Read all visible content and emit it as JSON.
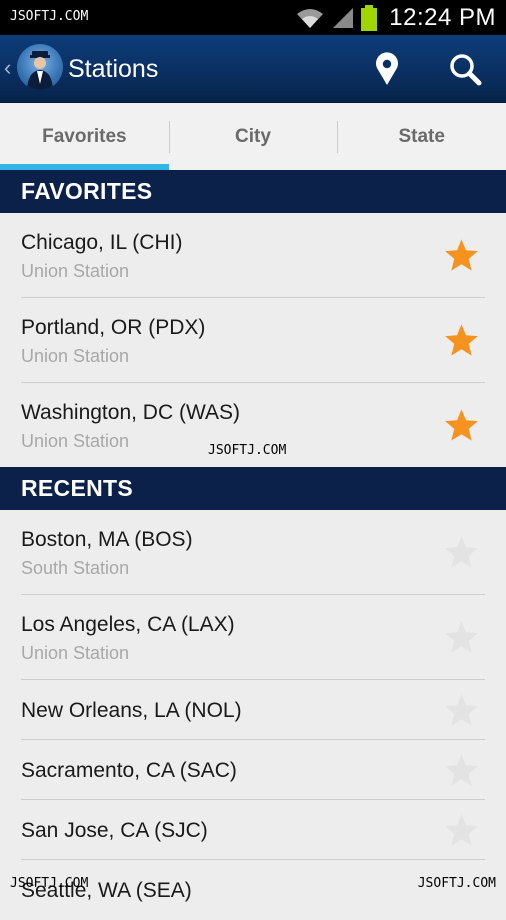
{
  "status_bar": {
    "watermark": "JSOFTJ.COM",
    "time": "12:24 PM",
    "watermark_right": "JSOFTJ.COM"
  },
  "action_bar": {
    "title": "Stations",
    "back_icon": "chevron-left-icon",
    "logo_icon": "conductor-logo-icon",
    "location_icon": "location-pin-icon",
    "search_icon": "search-icon"
  },
  "tabs": [
    {
      "label": "Favorites",
      "active": true
    },
    {
      "label": "City",
      "active": false
    },
    {
      "label": "State",
      "active": false
    }
  ],
  "favorites": {
    "header": "FAVORITES",
    "items": [
      {
        "name": "Chicago, IL (CHI)",
        "sub": "Union Station"
      },
      {
        "name": "Portland, OR (PDX)",
        "sub": "Union Station"
      },
      {
        "name": "Washington, DC (WAS)",
        "sub": "Union Station"
      }
    ]
  },
  "recents": {
    "header": "RECENTS",
    "items": [
      {
        "name": "Boston, MA (BOS)",
        "sub": "South Station"
      },
      {
        "name": "Los Angeles, CA (LAX)",
        "sub": "Union Station"
      },
      {
        "name": "New Orleans, LA (NOL)",
        "sub": ""
      },
      {
        "name": "Sacramento, CA (SAC)",
        "sub": ""
      },
      {
        "name": "San Jose, CA (SJC)",
        "sub": ""
      },
      {
        "name": "Seattle, WA (SEA)",
        "sub": ""
      }
    ]
  },
  "watermarks": {
    "middle": "JSOFTJ.COM",
    "bottom_left": "JSOFTJ.COM",
    "bottom_right": "JSOFTJ.COM"
  },
  "colors": {
    "accent": "#33b5e5",
    "star_on": "#f6931f",
    "header_bg": "#0b2149"
  }
}
